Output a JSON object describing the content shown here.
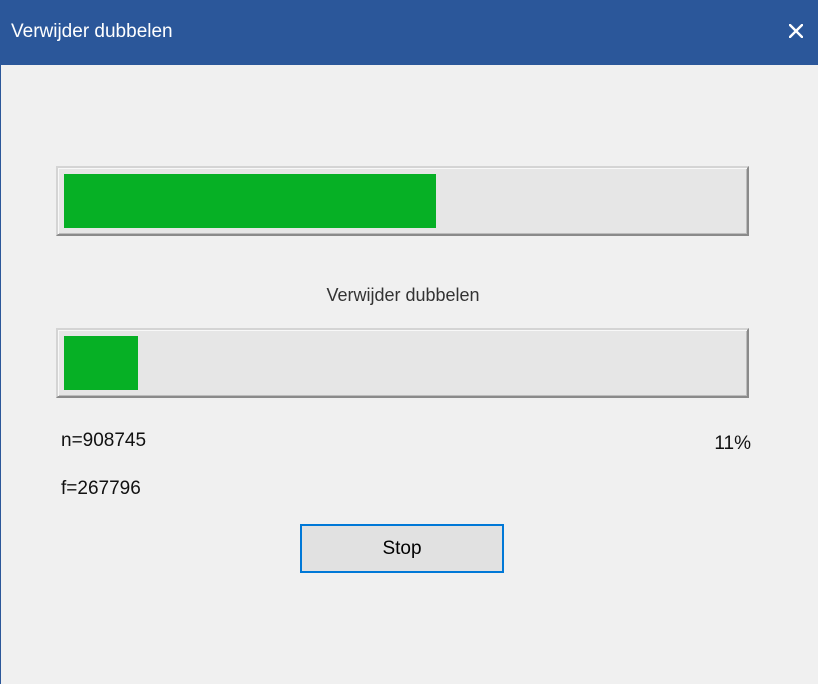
{
  "window": {
    "title": "Verwijder dubbelen",
    "close_icon": "close-icon",
    "titlebar_color": "#2b579a"
  },
  "progress": {
    "overall_fraction": 0.55,
    "current_fraction": 0.11,
    "fill_color": "#06b025"
  },
  "status": {
    "label": "Verwijder dubbelen",
    "n": "n=908745",
    "f": "f=267796",
    "percent": "11%"
  },
  "buttons": {
    "stop_label": "Stop"
  }
}
